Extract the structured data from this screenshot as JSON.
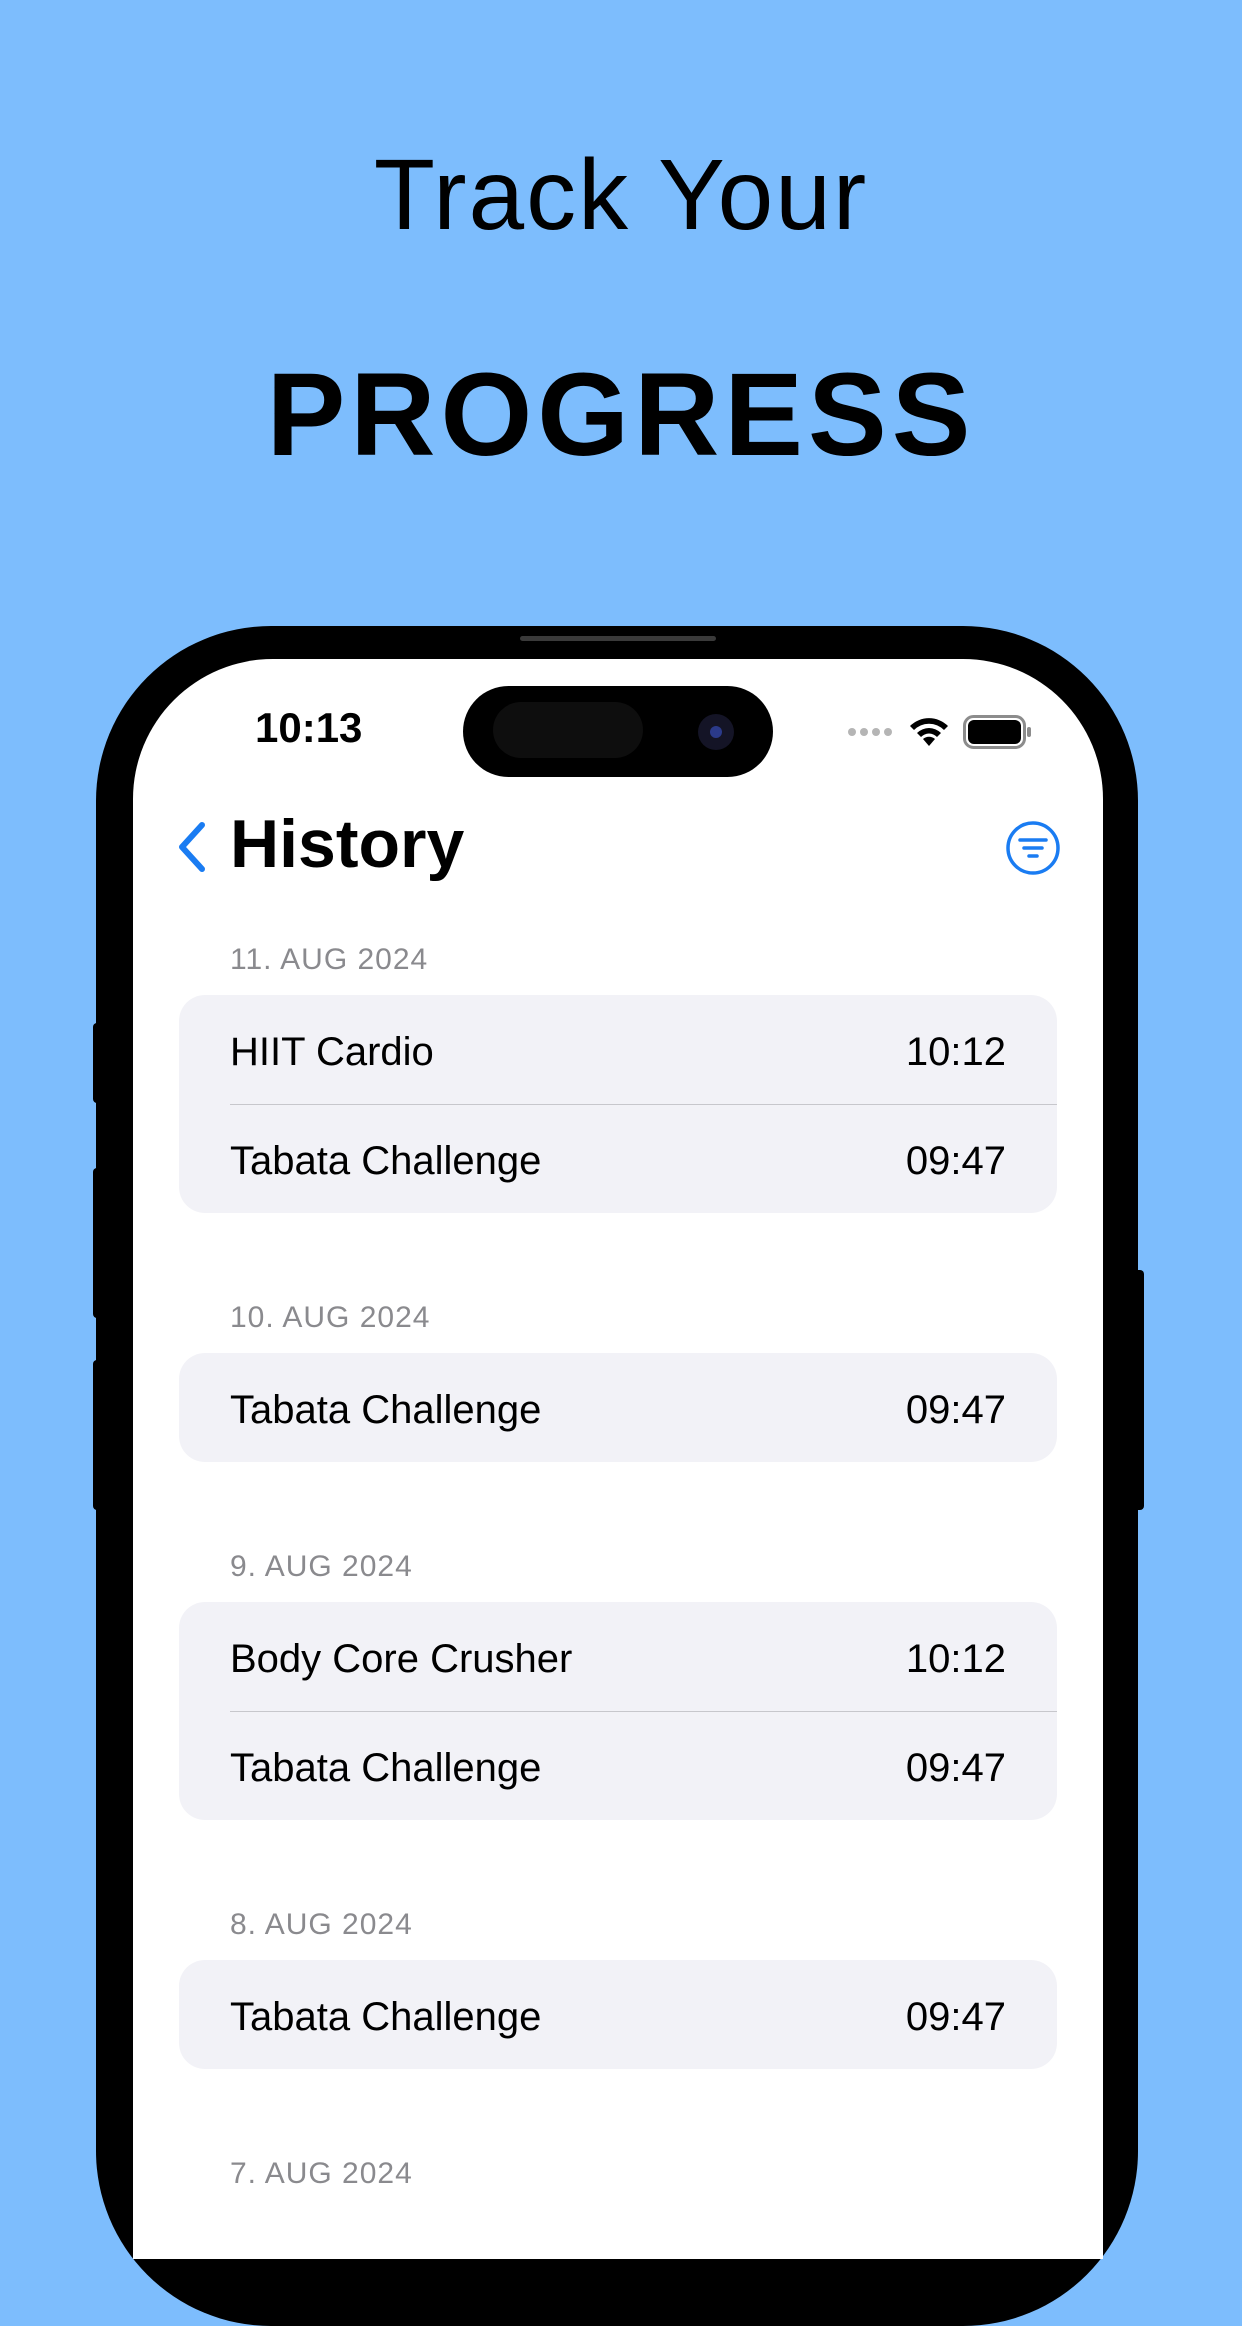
{
  "promo": {
    "line1": "Track Your",
    "line2": "PROGRESS"
  },
  "status_bar": {
    "time": "10:13",
    "icons": [
      "signal-dots-icon",
      "wifi-icon",
      "battery-icon"
    ]
  },
  "nav": {
    "title": "History",
    "back_icon": "chevron-left-icon",
    "filter_icon": "filter-circle-icon"
  },
  "colors": {
    "background": "#7dbdfd",
    "accent": "#1a7cf2",
    "row_fill": "#f2f2f7",
    "section_header": "#8a8a8e"
  },
  "sections": [
    {
      "date": "11. AUG 2024",
      "items": [
        {
          "name": "HIIT Cardio",
          "time": "10:12"
        },
        {
          "name": "Tabata Challenge",
          "time": "09:47"
        }
      ]
    },
    {
      "date": "10. AUG 2024",
      "items": [
        {
          "name": "Tabata Challenge",
          "time": "09:47"
        }
      ]
    },
    {
      "date": "9. AUG 2024",
      "items": [
        {
          "name": "Body Core Crusher",
          "time": "10:12"
        },
        {
          "name": "Tabata Challenge",
          "time": "09:47"
        }
      ]
    },
    {
      "date": "8. AUG 2024",
      "items": [
        {
          "name": "Tabata Challenge",
          "time": "09:47"
        }
      ]
    },
    {
      "date": "7. AUG 2024",
      "items": []
    }
  ]
}
